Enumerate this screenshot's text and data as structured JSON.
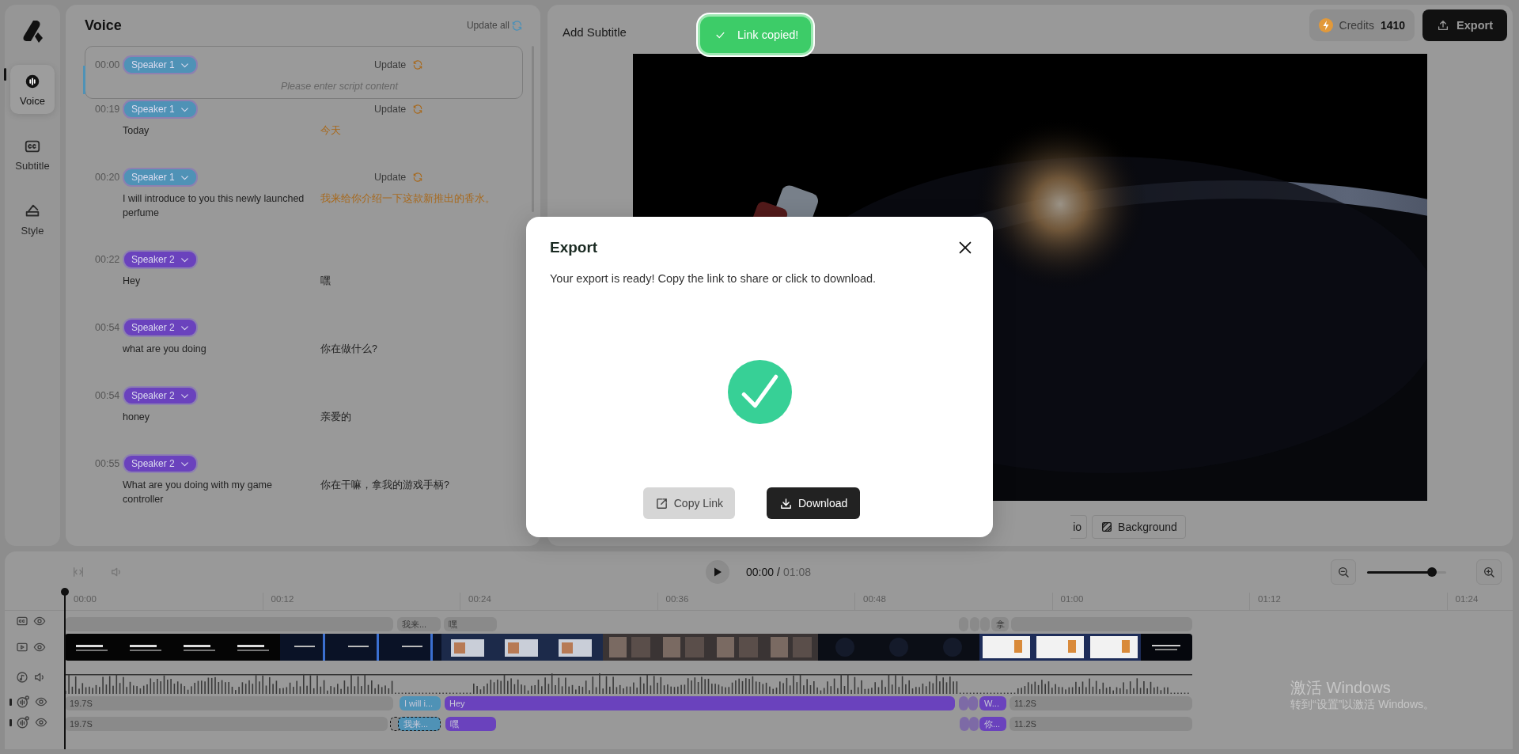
{
  "nav": {
    "items": [
      {
        "label": "Voice",
        "kind": "voice",
        "selected": true
      },
      {
        "label": "Subtitle",
        "kind": "subtitle",
        "selected": false
      },
      {
        "label": "Style",
        "kind": "style",
        "selected": false
      }
    ]
  },
  "voice": {
    "title": "Voice",
    "update_all": "Update all",
    "rows": [
      {
        "time": "00:00",
        "speaker": "Speaker 1",
        "color": "#4f92b6",
        "update": "Update",
        "selected": true,
        "placeholder": "Please enter script content"
      },
      {
        "time": "00:19",
        "speaker": "Speaker 1",
        "color": "#4f92b6",
        "update": "Update",
        "selected": false,
        "source": "Today",
        "translation": "今天",
        "highlighted": true
      },
      {
        "time": "00:20",
        "speaker": "Speaker 1",
        "color": "#4f92b6",
        "update": "Update",
        "selected": false,
        "source": "I will introduce to you this newly launched perfume",
        "translation": "我来给你介绍一下这款新推出的香水。",
        "highlighted": true
      },
      {
        "time": "00:22",
        "speaker": "Speaker 2",
        "color": "#6a42bd",
        "selected": false,
        "source": "Hey",
        "translation": "嘿",
        "highlighted": false
      },
      {
        "time": "00:54",
        "speaker": "Speaker 2",
        "color": "#6a42bd",
        "selected": false,
        "source": "what are you doing",
        "translation": "你在做什么?",
        "highlighted": false
      },
      {
        "time": "00:54",
        "speaker": "Speaker 2",
        "color": "#6a42bd",
        "selected": false,
        "source": "honey",
        "translation": "亲爱的",
        "highlighted": false
      },
      {
        "time": "00:55",
        "speaker": "Speaker 2",
        "color": "#6a42bd",
        "selected": false,
        "source": "What are you doing with my game controller",
        "translation": "你在干嘛，拿我的游戏手柄?",
        "highlighted": false
      }
    ]
  },
  "preview": {
    "title": "Add Subtitle",
    "credits_label": "Credits",
    "credits": "1410",
    "export": "Export",
    "tools": [
      {
        "label": "io",
        "kind": "ratio"
      },
      {
        "label": "Background",
        "kind": "background"
      }
    ]
  },
  "toast": {
    "text": "Link copied!"
  },
  "timeline": {
    "current": "00:00",
    "separator": "/",
    "duration": "01:08",
    "zoom": {
      "level": 0.82
    },
    "ruler": [
      "00:00",
      "00:12",
      "00:24",
      "00:36",
      "00:48",
      "01:00",
      "01:12",
      "01:24"
    ],
    "tracks": [
      {
        "kind": "subtitle",
        "clips": [
          {
            "kind": "gap"
          },
          {
            "kind": "gap",
            "label": "我来..."
          },
          {
            "kind": "gap",
            "label": "嘿"
          },
          {
            "kind": "gap"
          },
          {
            "kind": "gap"
          },
          {
            "kind": "gap"
          },
          {
            "kind": "gap",
            "label": "拿"
          },
          {
            "kind": "gap"
          }
        ]
      },
      {
        "kind": "video"
      },
      {
        "kind": "audio"
      },
      {
        "kind": "voice",
        "clips": [
          {
            "kind": "gap",
            "label": "19.7S",
            "selected": false
          },
          {
            "kind": "speaker",
            "label": "I will i...",
            "color": "#4f92b6",
            "selected": false
          },
          {
            "kind": "speaker",
            "label": "Hey",
            "color": "#6a42bd",
            "selected": false
          },
          {
            "kind": "speaker",
            "color": "#7d6aa6",
            "selected": false
          },
          {
            "kind": "speaker",
            "color": "#7d6aa6",
            "selected": false
          },
          {
            "kind": "speaker",
            "label": "W...",
            "color": "#6a42bd",
            "selected": false
          },
          {
            "kind": "gap",
            "label": "11.2S",
            "selected": false
          }
        ]
      },
      {
        "kind": "voice",
        "clips": [
          {
            "kind": "gap",
            "label": "19.7S",
            "selected": false
          },
          {
            "kind": "gap",
            "selected": true
          },
          {
            "kind": "speaker",
            "label": "我来...",
            "color": "#4f92b6",
            "selected": true
          },
          {
            "kind": "speaker",
            "label": "嘿",
            "color": "#6a42bd",
            "selected": false
          },
          {
            "kind": "speaker",
            "color": "#7d6aa6",
            "selected": false
          },
          {
            "kind": "speaker",
            "color": "#7d6aa6",
            "selected": false
          },
          {
            "kind": "speaker",
            "label": "你...",
            "color": "#6a42bd",
            "selected": false
          },
          {
            "kind": "gap",
            "label": "11.2S",
            "selected": false
          }
        ]
      }
    ]
  },
  "modal": {
    "title": "Export",
    "message": "Your export is ready! Copy the link to share or click to download.",
    "copy": "Copy Link",
    "download": "Download"
  },
  "os_notice": {
    "title": "激活 Windows",
    "subtitle": "转到“设置”以激活 Windows。"
  }
}
